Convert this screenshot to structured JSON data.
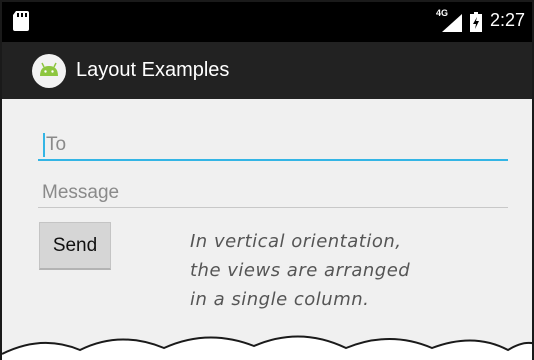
{
  "status_bar": {
    "network_label": "4G",
    "time": "2:27",
    "icons": [
      "sd-card-icon",
      "signal-icon",
      "battery-icon"
    ]
  },
  "action_bar": {
    "title": "Layout Examples",
    "icon": "android-icon"
  },
  "form": {
    "to_placeholder": "To",
    "message_placeholder": "Message",
    "send_label": "Send"
  },
  "annotation": {
    "lines": [
      "In vertical orientation,",
      "the views are arranged",
      "in a single column."
    ]
  },
  "colors": {
    "accent": "#33b5e5",
    "status_bar": "#000000",
    "action_bar": "#222222",
    "background": "#f0f0f0"
  }
}
